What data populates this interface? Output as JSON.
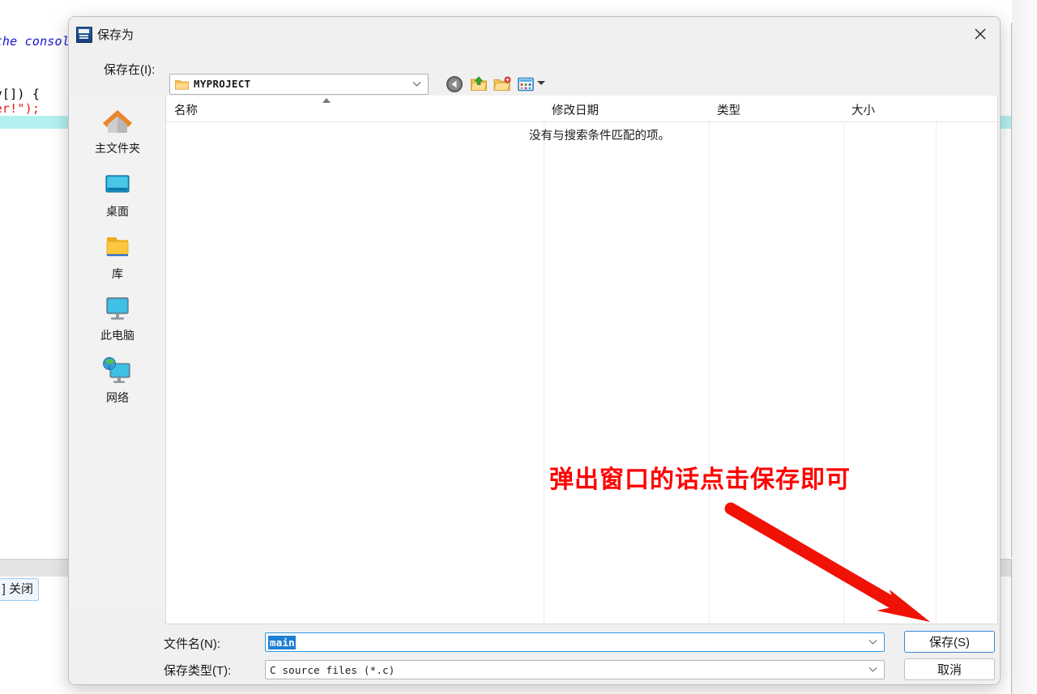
{
  "background": {
    "code_lines": [
      "   the console window",
      "argv[]) {",
      "inner!\");"
    ],
    "close_button_label": "] 关闭"
  },
  "dialog": {
    "title": "保存为",
    "app_icon": "dev-cpp-icon",
    "close_icon": "close-icon",
    "toolbar": {
      "save_in_label": "保存在(I):",
      "path_value": "MYPROJECT",
      "path_folder_icon": "folder-icon",
      "path_chevron_icon": "chevron-down-icon",
      "icons": [
        {
          "name": "back-icon",
          "title": "后退"
        },
        {
          "name": "up-folder-icon",
          "title": "上一级"
        },
        {
          "name": "new-folder-icon",
          "title": "新建文件夹"
        },
        {
          "name": "view-menu-icon",
          "title": "查看"
        }
      ]
    },
    "places": [
      {
        "label": "主文件夹",
        "icon": "home-icon"
      },
      {
        "label": "桌面",
        "icon": "desktop-icon"
      },
      {
        "label": "库",
        "icon": "library-folder-icon"
      },
      {
        "label": "此电脑",
        "icon": "this-pc-icon"
      },
      {
        "label": "网络",
        "icon": "network-icon"
      }
    ],
    "columns": [
      {
        "label": "名称"
      },
      {
        "label": "修改日期"
      },
      {
        "label": "类型"
      },
      {
        "label": "大小"
      }
    ],
    "empty_message": "没有与搜索条件匹配的项。",
    "form": {
      "filename_label": "文件名(N):",
      "filename_value": "main",
      "filetype_label": "保存类型(T):",
      "filetype_value": "C source files (*.c)",
      "chevron_icon": "chevron-down-icon"
    },
    "buttons": {
      "save_label": "保存(S)",
      "cancel_label": "取消"
    }
  },
  "annotation": {
    "text": "弹出窗口的话点击保存即可",
    "color": "#ff0000",
    "arrow_icon": "arrow-pointer-icon"
  }
}
